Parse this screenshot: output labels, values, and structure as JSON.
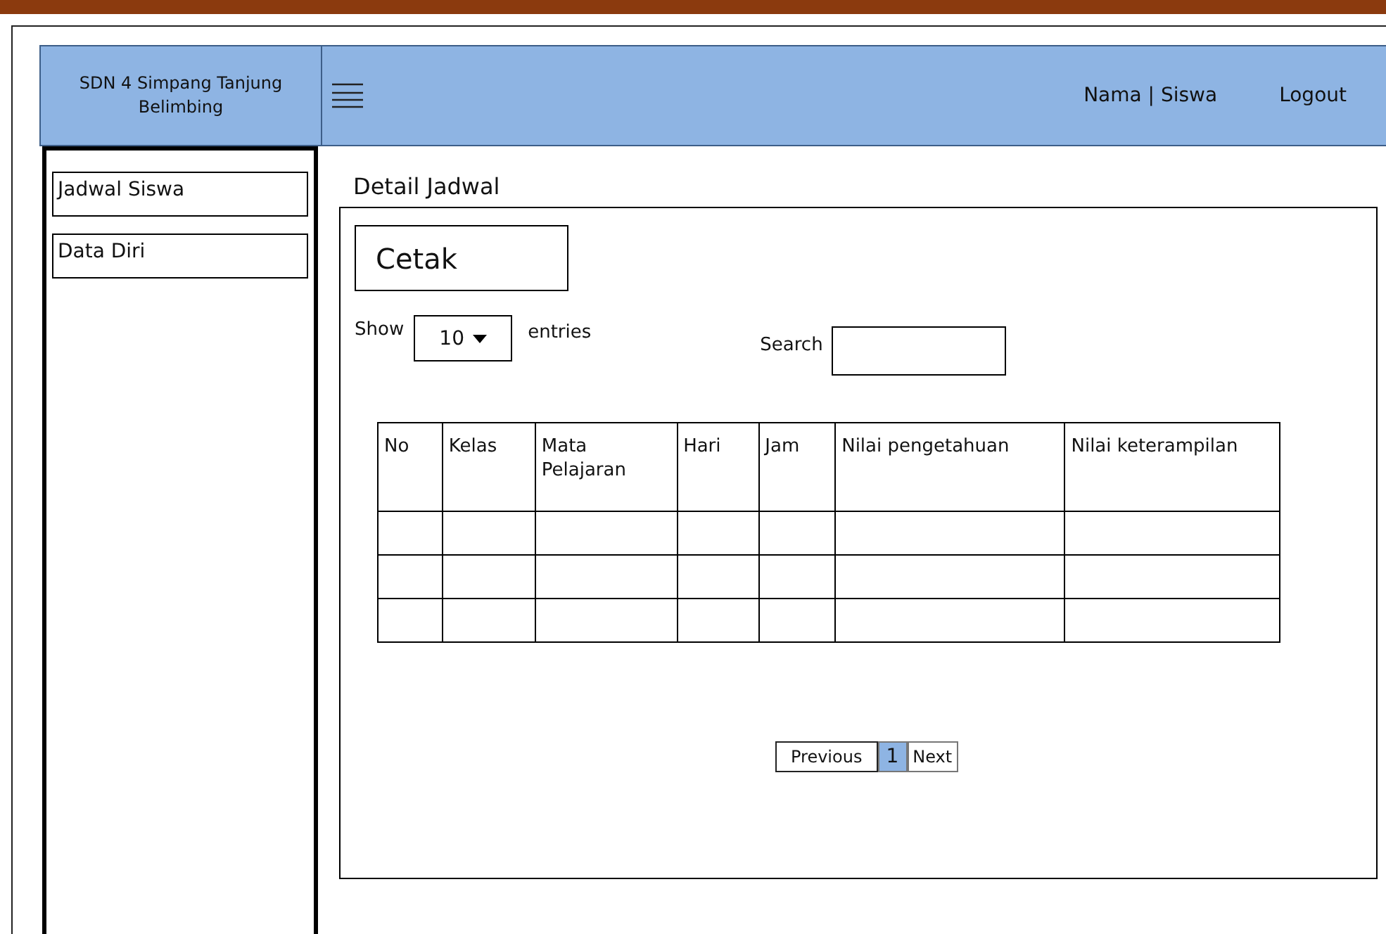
{
  "header": {
    "school_name": "SDN 4 Simpang Tanjung Belimbing",
    "user": "Nama | Siswa",
    "logout": "Logout"
  },
  "sidebar": {
    "items": [
      {
        "label": "Jadwal Siswa"
      },
      {
        "label": "Data Diri"
      }
    ]
  },
  "page_title": "Detail Jadwal",
  "print_button": "Cetak",
  "show_entries": {
    "show_label": "Show",
    "value": "10",
    "entries_label": "entries"
  },
  "search": {
    "label": "Search"
  },
  "table": {
    "columns": [
      "No",
      "Kelas",
      "Mata Pelajaran",
      "Hari",
      "Jam",
      "Nilai pengetahuan",
      "Nilai keterampilan"
    ],
    "rows": [
      {
        "kind": "empty"
      },
      {
        "kind": "empty"
      },
      {
        "kind": "empty"
      }
    ]
  },
  "pagination": {
    "previous": "Previous",
    "pages": [
      {
        "label": "1",
        "selected": true
      }
    ],
    "next": "Next"
  }
}
